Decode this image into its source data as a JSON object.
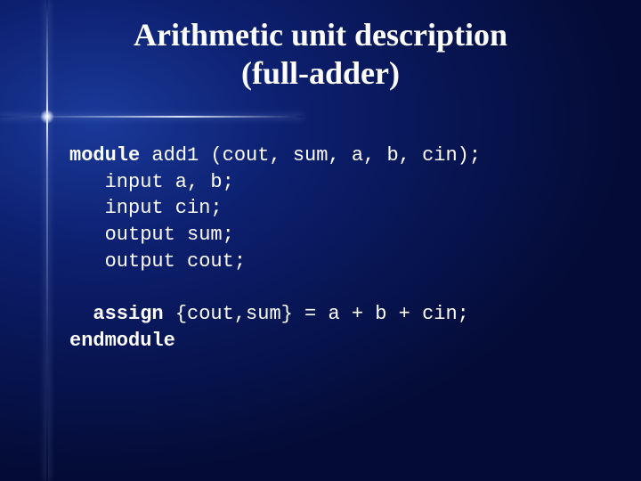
{
  "title": {
    "line1": "Arithmetic unit description",
    "line2": "(full-adder)"
  },
  "code": {
    "l1_kw": "module",
    "l1_rest": " add1 (cout, sum, a, b, cin);",
    "l2": "input a, b;",
    "l3": "input cin;",
    "l4": "output sum;",
    "l5": "output cout;",
    "l6_kw": "assign",
    "l6_rest": " {cout,sum} = a + b + cin;",
    "l7_kw": "endmodule"
  }
}
